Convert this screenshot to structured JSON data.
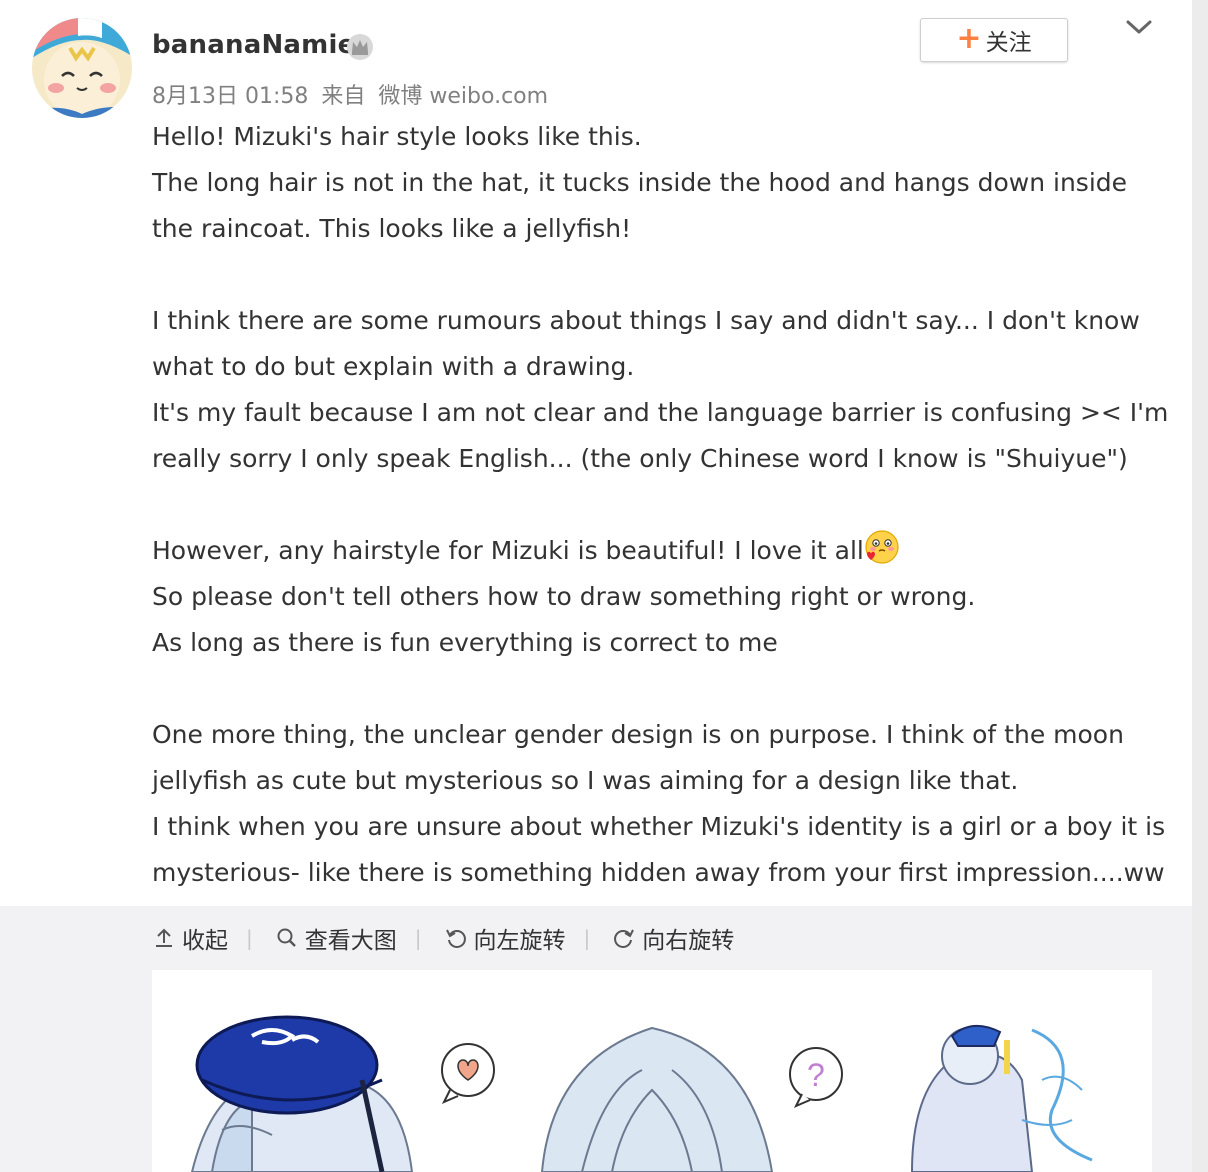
{
  "user": {
    "name": "bananaNamie",
    "meta": {
      "date": "8月13日 01:58",
      "from_label": "来自",
      "source": "微博 weibo.com"
    }
  },
  "follow_button": {
    "plus": "+",
    "label": "关注"
  },
  "post": {
    "paragraphs": [
      [
        "Hello! Mizuki's hair style looks like this.",
        "The long hair is not in the hat, it tucks inside the hood and hangs down inside",
        "the raincoat. This looks like a jellyfish!"
      ],
      [
        "I think there are some rumours about things I say and didn't say... I don't know",
        "what to do but explain with a drawing.",
        "It's my fault because I am not clear and the language barrier is confusing ><  I'm",
        "really sorry I only speak English... (the only Chinese word I know is \"Shuiyue\")"
      ],
      [
        "However, any hairstyle for Mizuki is beautiful! I love it all",
        "So please don't tell others how to draw something right or wrong.",
        "As long as there is fun everything is correct to me"
      ],
      [
        "One more thing, the unclear gender design is on purpose. I think of the moon",
        "jellyfish as cute but mysterious so I was aiming for a design like that.",
        "I think when you are unsure about whether Mizuki's identity is a girl or a boy it is",
        "mysterious- like there is something hidden away from your first impression....ww"
      ]
    ],
    "emoji_icon": "love-emoji-icon"
  },
  "toolbar": {
    "collapse": "收起",
    "view_large": "查看大图",
    "rotate_left": "向左旋转",
    "rotate_right": "向右旋转"
  },
  "colors": {
    "accent_plus": "#ff8140",
    "text": "#333333",
    "meta": "#808080",
    "media_bg": "#f2f2f5"
  }
}
